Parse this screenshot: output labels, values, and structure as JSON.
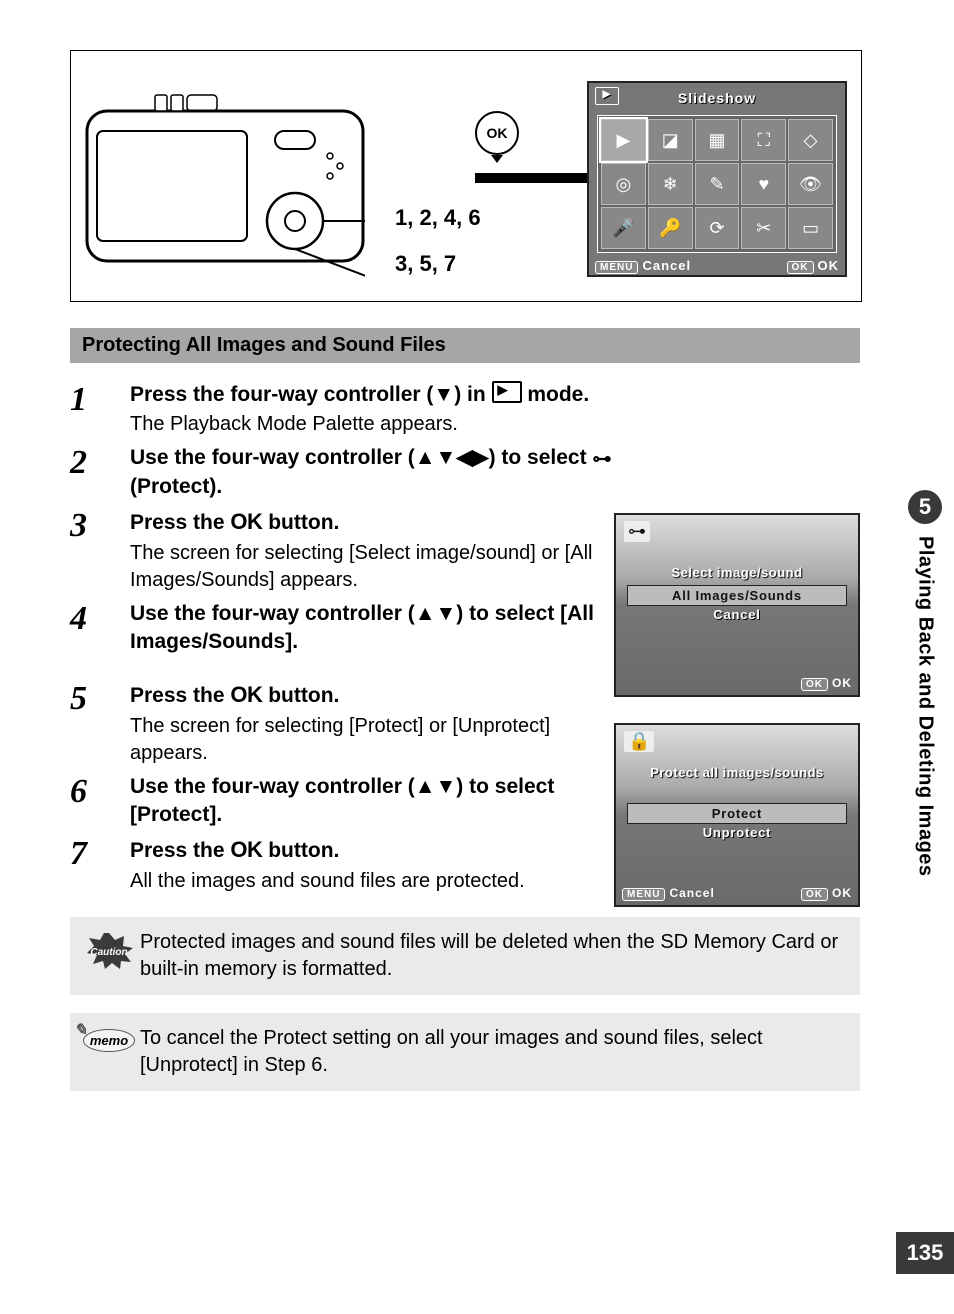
{
  "chapter": {
    "number": "5",
    "title": "Playing Back and Deleting Images"
  },
  "page_number": "135",
  "diagram": {
    "ok_label": "OK",
    "step_labels_1": "1, 2, 4, 6",
    "step_labels_2": "3, 5, 7",
    "lcd": {
      "title": "Slideshow",
      "menu_label": "MENU",
      "cancel": "Cancel",
      "ok_btn": "OK",
      "ok_text": "OK",
      "icons": [
        "▶",
        "◪",
        "▦",
        "⛶",
        "◇",
        "◎",
        "❄",
        "✎",
        "♥",
        "👁",
        "🎤",
        "🔑",
        "⟳",
        "✂",
        "▭"
      ]
    }
  },
  "section_header": "Protecting All Images and Sound Files",
  "steps": [
    {
      "n": "1",
      "head_parts": [
        "Press the four-way controller (▼) in ",
        " mode."
      ],
      "sub": "The Playback Mode Palette appears."
    },
    {
      "n": "2",
      "head_parts": [
        "Use the four-way controller (▲▼◀▶) to select ",
        "(Protect)."
      ]
    },
    {
      "n": "3",
      "head_parts": [
        "Press the ",
        " button."
      ],
      "ok_inline": "OK",
      "sub": "The screen for selecting [Select image/sound] or [All Images/Sounds] appears."
    },
    {
      "n": "4",
      "head_parts": [
        "Use the four-way controller (▲▼) to select [All Images/Sounds]."
      ]
    },
    {
      "n": "5",
      "head_parts": [
        "Press the ",
        " button."
      ],
      "ok_inline": "OK",
      "sub": "The screen for selecting [Protect] or [Unprotect] appears."
    },
    {
      "n": "6",
      "head_parts": [
        "Use the four-way controller (▲▼) to select [Protect]."
      ]
    },
    {
      "n": "7",
      "head_parts": [
        "Press the ",
        " button."
      ],
      "ok_inline": "OK",
      "sub": "All the images and sound files are protected."
    }
  ],
  "mini_lcd_a": {
    "icon": "⊶",
    "title": "Select image/sound",
    "items": [
      {
        "label": "All Images/Sounds",
        "selected": true
      },
      {
        "label": "Cancel",
        "selected": false
      }
    ],
    "foot_ok_btn": "OK",
    "foot_ok": "OK"
  },
  "mini_lcd_b": {
    "icon": "🔒",
    "title": "Protect all images/sounds",
    "items": [
      {
        "label": "Protect",
        "selected": true
      },
      {
        "label": "Unprotect",
        "selected": false
      }
    ],
    "foot_menu": "MENU",
    "foot_cancel": "Cancel",
    "foot_ok_btn": "OK",
    "foot_ok": "OK"
  },
  "caution_label": "Caution",
  "caution_text": "Protected images and sound files will be deleted when the SD Memory Card or built-in memory is formatted.",
  "memo_label": "memo",
  "memo_text": "To cancel the Protect setting on all your images and sound files, select [Unprotect] in Step 6."
}
